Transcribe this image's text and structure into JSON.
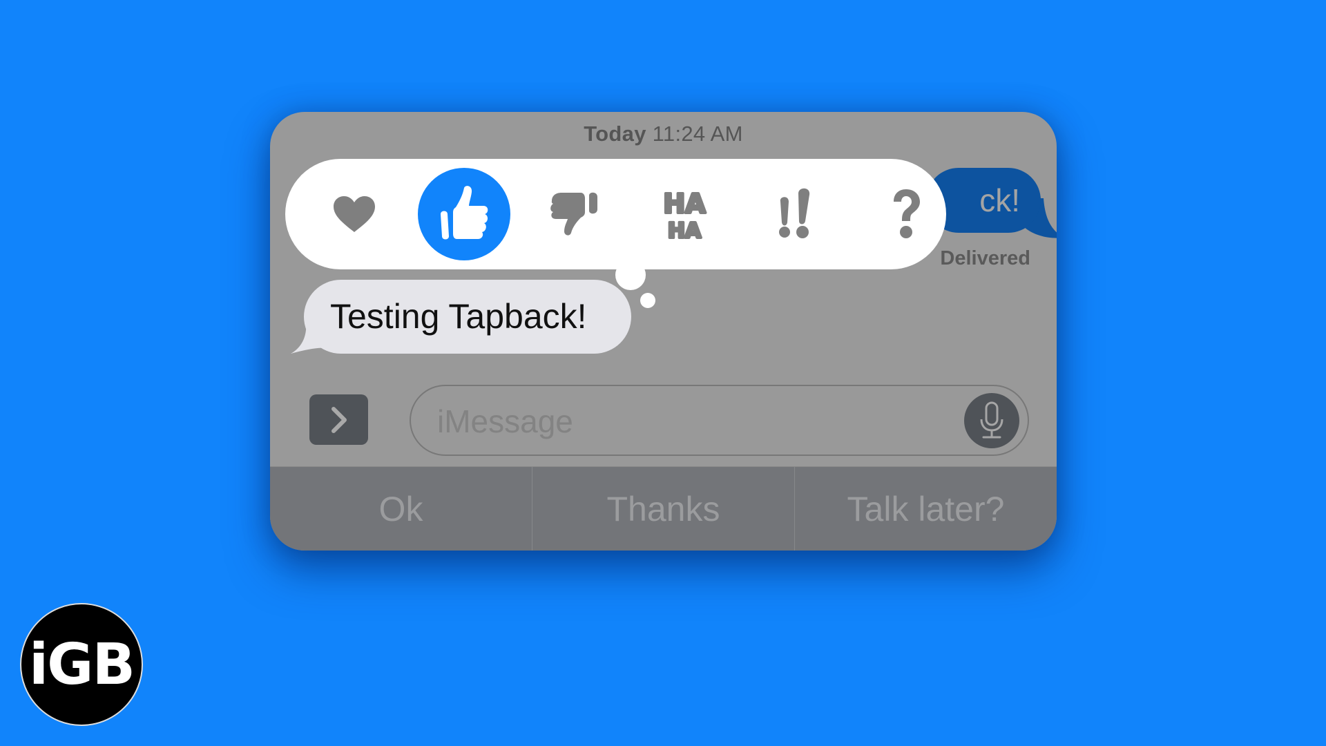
{
  "conversation": {
    "timestamp_day": "Today",
    "timestamp_time": "11:24 AM",
    "sent_message_visible_text": "ck!",
    "sent_status": "Delivered",
    "received_message": "Testing Tapback!"
  },
  "tapback": {
    "selected": "thumbs-up",
    "options": [
      {
        "name": "heart",
        "icon": "heart-icon"
      },
      {
        "name": "thumbs-up",
        "icon": "thumbs-up-icon"
      },
      {
        "name": "thumbs-down",
        "icon": "thumbs-down-icon"
      },
      {
        "name": "haha",
        "icon": "haha-icon",
        "label_top": "HA",
        "label_bottom": "HA"
      },
      {
        "name": "emphasize",
        "icon": "double-exclamation-icon",
        "label": "!!"
      },
      {
        "name": "question",
        "icon": "question-mark-icon",
        "label": "?"
      }
    ]
  },
  "composer": {
    "apps_button_icon": "chevron-right-icon",
    "placeholder": "iMessage",
    "mic_icon": "microphone-icon"
  },
  "quick_replies": [
    "Ok",
    "Thanks",
    "Talk later?"
  ],
  "logo": {
    "text": "iGB"
  },
  "colors": {
    "background": "#1184fb",
    "card": "#999999",
    "tapback_selected": "#1184fb",
    "sent_bubble": "#0d539f",
    "received_bubble": "#e5e5ea",
    "quick_bar": "#737579"
  }
}
